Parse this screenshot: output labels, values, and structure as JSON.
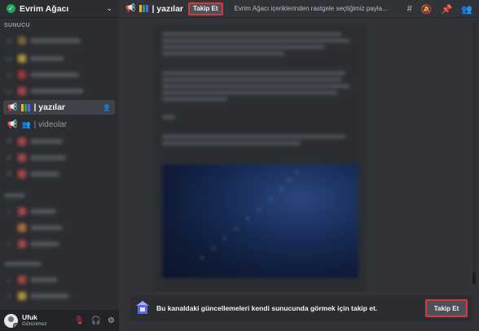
{
  "server": {
    "name": "Evrim Ağacı"
  },
  "sidebar": {
    "category": "SUNUCU",
    "active_channel": {
      "label": "| yazılar"
    },
    "video_channel": {
      "label": "| videolar"
    }
  },
  "user": {
    "name": "Ufuk",
    "status": "Görünmez"
  },
  "topbar": {
    "channel": "| yazılar",
    "follow_label": "Takip Et",
    "topic": "Evrim Ağacı içeriklerinden rastgele seçtiğimiz payla..."
  },
  "banner": {
    "text": "Bu kanaldaki güncellemeleri kendi sunucunda görmek için takip et.",
    "follow_label": "Takip Et"
  },
  "colors": {
    "accent": "#5865f2",
    "highlight_border": "#da373c",
    "online": "#23a55a",
    "bar_yellow": "#f0b232",
    "bar_green": "#23a55a",
    "bar_blue": "#5865f2"
  }
}
